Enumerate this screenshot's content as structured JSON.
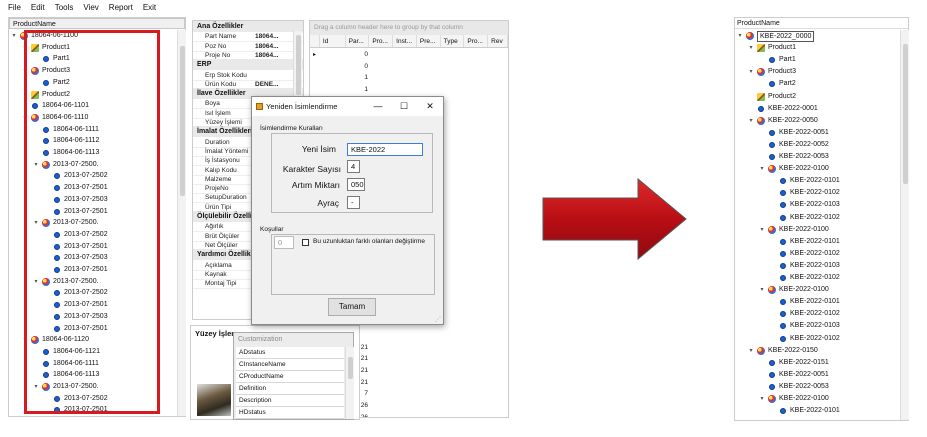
{
  "menu": {
    "file": "File",
    "edit": "Edit",
    "tools": "Tools",
    "view": "Viev",
    "report": "Report",
    "exit": "Exit"
  },
  "left_tree": {
    "header": "ProductName",
    "rows": [
      {
        "label": "18064-06-1100",
        "icon": "assembly-icon",
        "indent": 0,
        "chev": "▾"
      },
      {
        "label": "Product1",
        "icon": "pencil-icon",
        "indent": 1,
        "chev": "▾"
      },
      {
        "label": "Part1",
        "icon": "part-icon",
        "indent": 2,
        "chev": ""
      },
      {
        "label": "Product3",
        "icon": "assembly-icon",
        "indent": 1,
        "chev": "▾"
      },
      {
        "label": "Part2",
        "icon": "part-icon",
        "indent": 2,
        "chev": ""
      },
      {
        "label": "Product2",
        "icon": "pencil-icon",
        "indent": 1,
        "chev": ""
      },
      {
        "label": "18064-06-1101",
        "icon": "part-icon",
        "indent": 1,
        "chev": ""
      },
      {
        "label": "18064-06-1110",
        "icon": "assembly-icon",
        "indent": 1,
        "chev": "▾"
      },
      {
        "label": "18064-06-1111",
        "icon": "part-icon",
        "indent": 2,
        "chev": ""
      },
      {
        "label": "18064-06-1112",
        "icon": "part-icon",
        "indent": 2,
        "chev": ""
      },
      {
        "label": "18064-06-1113",
        "icon": "part-icon",
        "indent": 2,
        "chev": ""
      },
      {
        "label": "2013-07-2500.",
        "icon": "assembly-icon",
        "indent": 2,
        "chev": "▾"
      },
      {
        "label": "2013-07-2502",
        "icon": "part-icon",
        "indent": 3,
        "chev": ""
      },
      {
        "label": "2013-07-2501",
        "icon": "part-icon",
        "indent": 3,
        "chev": ""
      },
      {
        "label": "2013-07-2503",
        "icon": "part-icon",
        "indent": 3,
        "chev": ""
      },
      {
        "label": "2013-07-2501",
        "icon": "part-icon",
        "indent": 3,
        "chev": ""
      },
      {
        "label": "2013-07-2500.",
        "icon": "assembly-icon",
        "indent": 2,
        "chev": "▾"
      },
      {
        "label": "2013-07-2502",
        "icon": "part-icon",
        "indent": 3,
        "chev": ""
      },
      {
        "label": "2013-07-2501",
        "icon": "part-icon",
        "indent": 3,
        "chev": ""
      },
      {
        "label": "2013-07-2503",
        "icon": "part-icon",
        "indent": 3,
        "chev": ""
      },
      {
        "label": "2013-07-2501",
        "icon": "part-icon",
        "indent": 3,
        "chev": ""
      },
      {
        "label": "2013-07-2500.",
        "icon": "assembly-icon",
        "indent": 2,
        "chev": "▾"
      },
      {
        "label": "2013-07-2502",
        "icon": "part-icon",
        "indent": 3,
        "chev": ""
      },
      {
        "label": "2013-07-2501",
        "icon": "part-icon",
        "indent": 3,
        "chev": ""
      },
      {
        "label": "2013-07-2503",
        "icon": "part-icon",
        "indent": 3,
        "chev": ""
      },
      {
        "label": "2013-07-2501",
        "icon": "part-icon",
        "indent": 3,
        "chev": ""
      },
      {
        "label": "18064-06-1120",
        "icon": "assembly-icon",
        "indent": 1,
        "chev": "▾"
      },
      {
        "label": "18064-06-1121",
        "icon": "part-icon",
        "indent": 2,
        "chev": ""
      },
      {
        "label": "18064-06-1111",
        "icon": "part-icon",
        "indent": 2,
        "chev": ""
      },
      {
        "label": "18064-06-1113",
        "icon": "part-icon",
        "indent": 2,
        "chev": ""
      },
      {
        "label": "2013-07-2500.",
        "icon": "assembly-icon",
        "indent": 2,
        "chev": "▾"
      },
      {
        "label": "2013-07-2502",
        "icon": "part-icon",
        "indent": 3,
        "chev": ""
      },
      {
        "label": "2013-07-2501",
        "icon": "part-icon",
        "indent": 3,
        "chev": ""
      }
    ]
  },
  "props": {
    "groups": [
      {
        "title": "Ana Özellikler",
        "rows": [
          [
            "Part Name",
            "18064..."
          ],
          [
            "Poz No",
            "18064..."
          ],
          [
            "Proje No",
            "18064..."
          ]
        ]
      },
      {
        "title": "ERP",
        "rows": [
          [
            "Erp Stok Kodu",
            ""
          ],
          [
            "Ürün Kodu",
            "DENE..."
          ]
        ]
      },
      {
        "title": "İlave Özellikler",
        "rows": [
          [
            "Boya",
            ""
          ],
          [
            "Isıl İşlem",
            ""
          ],
          [
            "Yüzey İşlemi",
            ""
          ]
        ]
      },
      {
        "title": "İmalat Özellikleri",
        "rows": [
          [
            "Duration",
            ""
          ],
          [
            "İmalat Yöntemi",
            ""
          ],
          [
            "İş İstasyonu",
            ""
          ],
          [
            "Kalıp Kodu",
            ""
          ],
          [
            "Malzeme",
            ""
          ],
          [
            "ProjeNo",
            ""
          ],
          [
            "SetupDuration",
            ""
          ],
          [
            "Ürün Tipi",
            ""
          ]
        ]
      },
      {
        "title": "Ölçülebilir Özellikler",
        "rows": [
          [
            "Ağırlık",
            ""
          ],
          [
            "Brüt Ölçüler",
            ""
          ],
          [
            "Net Ölçüler",
            ""
          ]
        ]
      },
      {
        "title": "Yardımcı Özellikler",
        "rows": [
          [
            "Açıklama",
            ""
          ],
          [
            "Kaynak",
            ""
          ],
          [
            "Montaj Tipi",
            ""
          ]
        ]
      }
    ]
  },
  "grid": {
    "group_hint": "Drag a column header here to group by that column",
    "columns": [
      "Id",
      "Par...",
      "Pro...",
      "Inst...",
      "Pre...",
      "Type",
      "Pro...",
      "Rev"
    ],
    "par_values": [
      "0",
      "0",
      "1",
      "1",
      "",
      "",
      "",
      "",
      "",
      "",
      "",
      "",
      "",
      "",
      "",
      "",
      "",
      "",
      "",
      "",
      "",
      "",
      "",
      "",
      "",
      "21",
      "21",
      "21",
      "21",
      "7",
      "26",
      "26"
    ]
  },
  "bottom_panel": {
    "title": "Yüzey İşlem"
  },
  "customization": {
    "title": "Customization",
    "items": [
      "ADstatus",
      "CInstanceName",
      "CProductName",
      "Definition",
      "Description",
      "HDstatus"
    ]
  },
  "dialog": {
    "title": "Yeniden İsimlendirme",
    "rules_label": "İsimlendirme Kuralları",
    "new_name_label": "Yeni İsim",
    "new_name_value": "KBE-2022",
    "char_count_label": "Karakter Sayısı",
    "char_count_value": "4",
    "increment_label": "Artım Miktarı",
    "increment_value": "050",
    "separator_label": "Ayraç",
    "separator_value": "-",
    "conditions_label": "Koşullar",
    "length_value": "0",
    "checkbox_label": "Bu uzunluktan farklı olanları değiştirme",
    "ok_label": "Tamam"
  },
  "colors": {
    "red_rect": "#d71920",
    "arrow": "#c40d17"
  },
  "right_tree": {
    "header": "ProductName",
    "rows": [
      {
        "label": "KBE-2022_0000",
        "icon": "assembly-icon",
        "indent": 0,
        "chev": "▾"
      },
      {
        "label": "Product1",
        "icon": "pencil-icon",
        "indent": 1,
        "chev": "▾"
      },
      {
        "label": "Part1",
        "icon": "part-icon",
        "indent": 2,
        "chev": ""
      },
      {
        "label": "Product3",
        "icon": "assembly-icon",
        "indent": 1,
        "chev": "▾"
      },
      {
        "label": "Part2",
        "icon": "part-icon",
        "indent": 2,
        "chev": ""
      },
      {
        "label": "Product2",
        "icon": "pencil-icon",
        "indent": 1,
        "chev": ""
      },
      {
        "label": "KBE-2022-0001",
        "icon": "part-icon",
        "indent": 1,
        "chev": ""
      },
      {
        "label": "KBE-2022-0050",
        "icon": "assembly-icon",
        "indent": 1,
        "chev": "▾"
      },
      {
        "label": "KBE-2022-0051",
        "icon": "part-icon",
        "indent": 2,
        "chev": ""
      },
      {
        "label": "KBE-2022-0052",
        "icon": "part-icon",
        "indent": 2,
        "chev": ""
      },
      {
        "label": "KBE-2022-0053",
        "icon": "part-icon",
        "indent": 2,
        "chev": ""
      },
      {
        "label": "KBE-2022-0100",
        "icon": "assembly-icon",
        "indent": 2,
        "chev": "▾"
      },
      {
        "label": "KBE-2022-0101",
        "icon": "part-icon",
        "indent": 3,
        "chev": ""
      },
      {
        "label": "KBE-2022-0102",
        "icon": "part-icon",
        "indent": 3,
        "chev": ""
      },
      {
        "label": "KBE-2022-0103",
        "icon": "part-icon",
        "indent": 3,
        "chev": ""
      },
      {
        "label": "KBE-2022-0102",
        "icon": "part-icon",
        "indent": 3,
        "chev": ""
      },
      {
        "label": "KBE-2022-0100",
        "icon": "assembly-icon",
        "indent": 2,
        "chev": "▾"
      },
      {
        "label": "KBE-2022-0101",
        "icon": "part-icon",
        "indent": 3,
        "chev": ""
      },
      {
        "label": "KBE-2022-0102",
        "icon": "part-icon",
        "indent": 3,
        "chev": ""
      },
      {
        "label": "KBE-2022-0103",
        "icon": "part-icon",
        "indent": 3,
        "chev": ""
      },
      {
        "label": "KBE-2022-0102",
        "icon": "part-icon",
        "indent": 3,
        "chev": ""
      },
      {
        "label": "KBE-2022-0100",
        "icon": "assembly-icon",
        "indent": 2,
        "chev": "▾"
      },
      {
        "label": "KBE-2022-0101",
        "icon": "part-icon",
        "indent": 3,
        "chev": ""
      },
      {
        "label": "KBE-2022-0102",
        "icon": "part-icon",
        "indent": 3,
        "chev": ""
      },
      {
        "label": "KBE-2022-0103",
        "icon": "part-icon",
        "indent": 3,
        "chev": ""
      },
      {
        "label": "KBE-2022-0102",
        "icon": "part-icon",
        "indent": 3,
        "chev": ""
      },
      {
        "label": "KBE-2022-0150",
        "icon": "assembly-icon",
        "indent": 1,
        "chev": "▾"
      },
      {
        "label": "KBE-2022-0151",
        "icon": "part-icon",
        "indent": 2,
        "chev": ""
      },
      {
        "label": "KBE-2022-0051",
        "icon": "part-icon",
        "indent": 2,
        "chev": ""
      },
      {
        "label": "KBE-2022-0053",
        "icon": "part-icon",
        "indent": 2,
        "chev": ""
      },
      {
        "label": "KBE-2022-0100",
        "icon": "assembly-icon",
        "indent": 2,
        "chev": "▾"
      },
      {
        "label": "KBE-2022-0101",
        "icon": "part-icon",
        "indent": 3,
        "chev": ""
      }
    ]
  }
}
